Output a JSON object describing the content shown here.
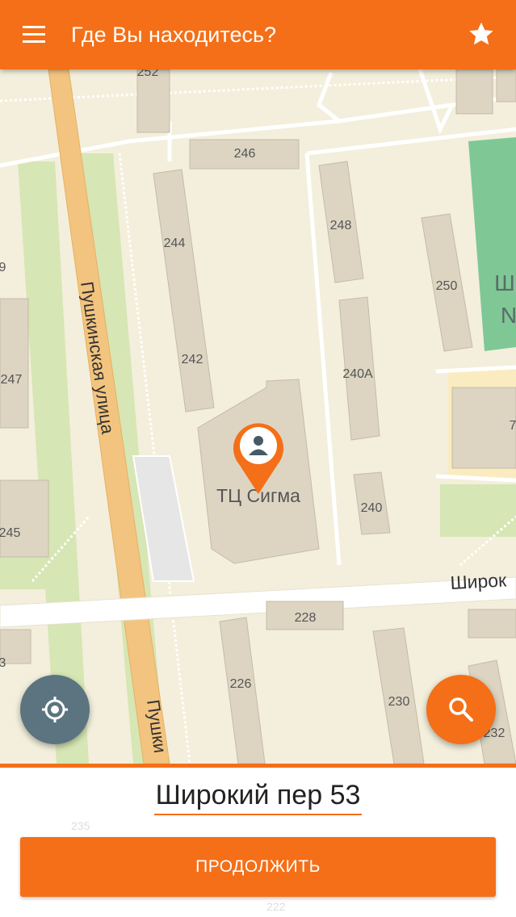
{
  "app_bar": {
    "title": "Где Вы находитесь?",
    "menu_icon": "hamburger-menu-icon",
    "star_icon": "star-icon"
  },
  "map": {
    "street_labels": [
      "Пушкинская улица",
      "Пушки",
      "Широк"
    ],
    "building_labels": [
      "252",
      "246",
      "244",
      "248",
      "250",
      "242",
      "247",
      "240А",
      "9",
      "7",
      "245",
      "240",
      "228",
      "226",
      "230",
      "232",
      "3"
    ],
    "poi_label": "ТЦ Сигма",
    "partial_labels": [
      "Ш",
      "N"
    ],
    "marker_icon": "user-location-pin-icon"
  },
  "fabs": {
    "locate_icon": "my-location-icon",
    "search_icon": "search-icon"
  },
  "bottom_panel": {
    "address": "Широкий пер 53",
    "continue_label": "ПРОДОЛЖИТЬ",
    "faint_labels": [
      "235",
      "222"
    ]
  },
  "colors": {
    "accent": "#f46f18",
    "locate_fab": "#5b7480",
    "map_background": "#f3efdc",
    "road_main": "#f5c67a",
    "green_area": "#d8e8b8",
    "building": "#ddd6c4"
  }
}
